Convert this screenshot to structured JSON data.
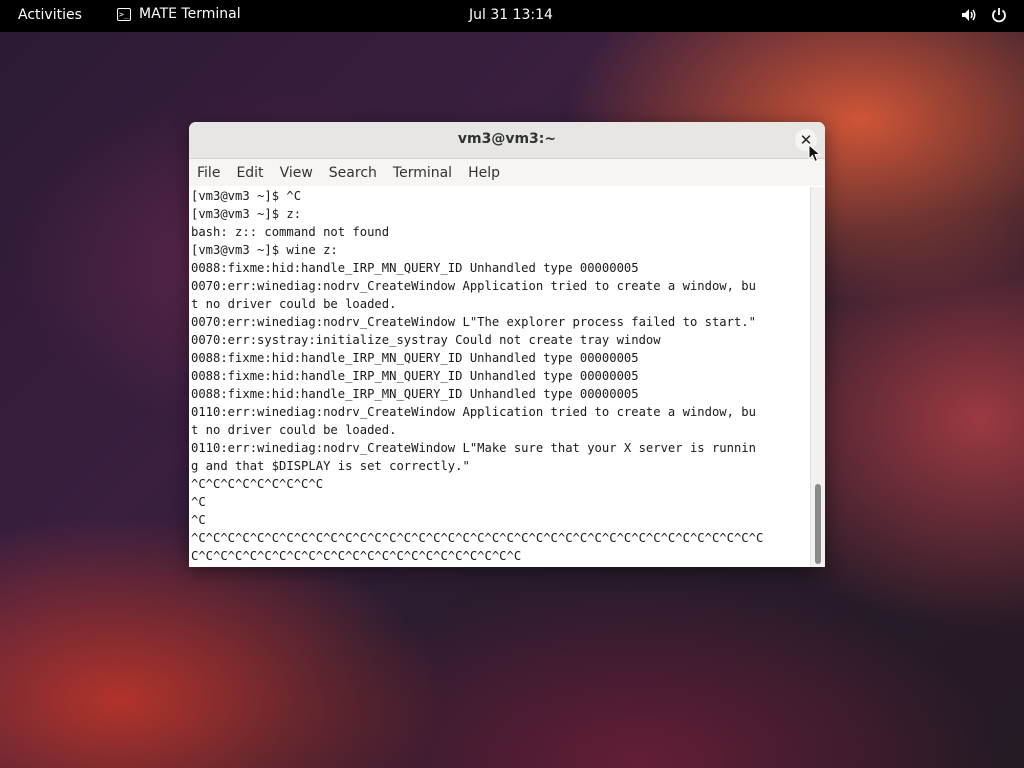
{
  "topbar": {
    "activities": "Activities",
    "app_name": "MATE Terminal",
    "app_icon": "terminal-icon",
    "clock": "Jul 31  13:14",
    "volume_icon": "volume-icon",
    "power_icon": "power-icon"
  },
  "window": {
    "title": "vm3@vm3:~",
    "close_label": "✕",
    "menu": [
      "File",
      "Edit",
      "View",
      "Search",
      "Terminal",
      "Help"
    ]
  },
  "terminal": {
    "lines": [
      "[vm3@vm3 ~]$ ^C",
      "[vm3@vm3 ~]$ z:",
      "bash: z:: command not found",
      "[vm3@vm3 ~]$ wine z:",
      "0088:fixme:hid:handle_IRP_MN_QUERY_ID Unhandled type 00000005",
      "0070:err:winediag:nodrv_CreateWindow Application tried to create a window, bu",
      "t no driver could be loaded.",
      "0070:err:winediag:nodrv_CreateWindow L\"The explorer process failed to start.\"",
      "0070:err:systray:initialize_systray Could not create tray window",
      "0088:fixme:hid:handle_IRP_MN_QUERY_ID Unhandled type 00000005",
      "0088:fixme:hid:handle_IRP_MN_QUERY_ID Unhandled type 00000005",
      "0088:fixme:hid:handle_IRP_MN_QUERY_ID Unhandled type 00000005",
      "0110:err:winediag:nodrv_CreateWindow Application tried to create a window, bu",
      "t no driver could be loaded.",
      "0110:err:winediag:nodrv_CreateWindow L\"Make sure that your X server is runnin",
      "g and that $DISPLAY is set correctly.\"",
      "^C^C^C^C^C^C^C^C^C",
      "^C",
      "^C",
      "^C^C^C^C^C^C^C^C^C^C^C^C^C^C^C^C^C^C^C^C^C^C^C^C^C^C^C^C^C^C^C^C^C^C^C^C^C^C^C",
      "C^C^C^C^C^C^C^C^C^C^C^C^C^C^C^C^C^C^C^C^C^C^C"
    ]
  }
}
